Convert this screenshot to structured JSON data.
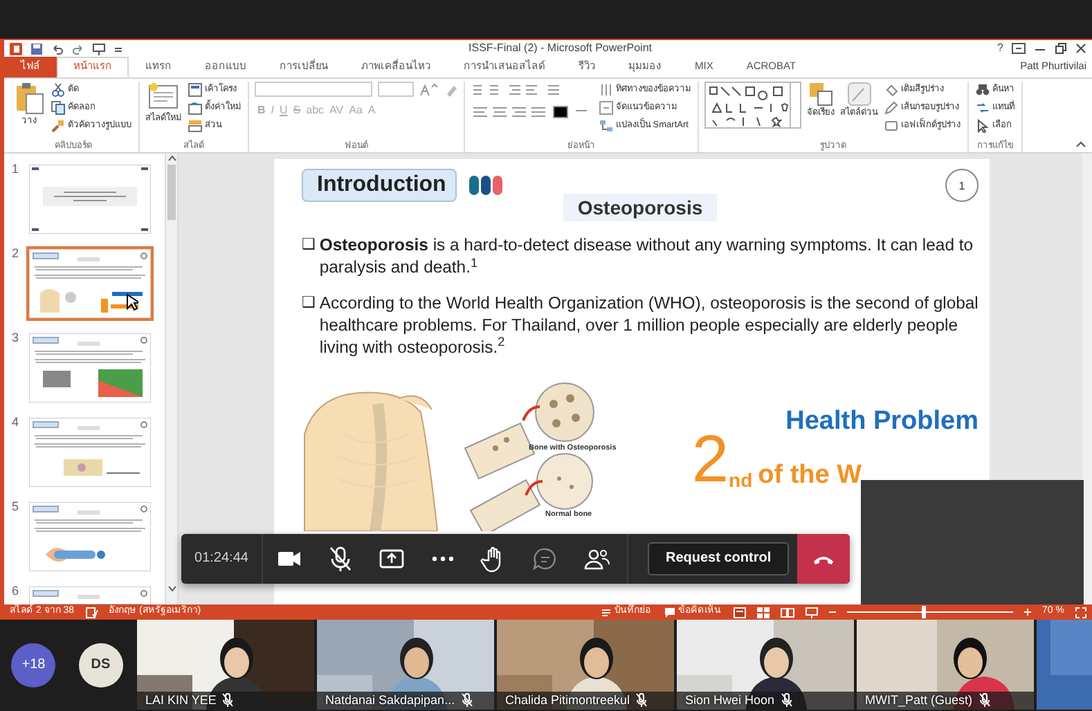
{
  "window": {
    "title": "ISSF-Final (2) - Microsoft PowerPoint",
    "help": "?",
    "user": "Patt Phurtivilai"
  },
  "tabs": [
    {
      "label": "ไฟล์",
      "kind": "file",
      "selected": false
    },
    {
      "label": "หน้าแรก",
      "kind": "tab",
      "selected": true
    },
    {
      "label": "แทรก",
      "kind": "tab",
      "selected": false
    },
    {
      "label": "ออกแบบ",
      "kind": "tab",
      "selected": false
    },
    {
      "label": "การเปลี่ยน",
      "kind": "tab",
      "selected": false
    },
    {
      "label": "ภาพเคลื่อนไหว",
      "kind": "tab",
      "selected": false
    },
    {
      "label": "การนำเสนอสไลด์",
      "kind": "tab",
      "selected": false
    },
    {
      "label": "รีวิว",
      "kind": "tab",
      "selected": false
    },
    {
      "label": "มุมมอง",
      "kind": "tab",
      "selected": false
    },
    {
      "label": "MIX",
      "kind": "tab",
      "selected": false
    },
    {
      "label": "ACROBAT",
      "kind": "tab",
      "selected": false
    }
  ],
  "ribbon": {
    "groups": [
      {
        "kind": "clipboard",
        "label": "คลิปบอร์ด",
        "items": [
          "วาง",
          "ตัด",
          "คัดลอก",
          "ตัวคัดวางรูปแบบ"
        ]
      },
      {
        "kind": "slides",
        "label": "สไลด์",
        "items": [
          "สไลด์ใหม่",
          "เค้าโครง",
          "ตั้งค่าใหม่",
          "ส่วน"
        ]
      },
      {
        "kind": "font",
        "label": "ฟอนต์",
        "disabled": true,
        "items": [
          "B",
          "I",
          "U",
          "S",
          "abc",
          "AV",
          "Aa",
          "A"
        ]
      },
      {
        "kind": "paragraph",
        "label": "ย่อหน้า",
        "items": [
          "ทิศทางของข้อความ",
          "จัดแนวข้อความ",
          "แปลงเป็น SmartArt"
        ]
      },
      {
        "kind": "drawing",
        "label": "รูปวาด",
        "items": [
          "จัดเรียง",
          "สไตล์ด่วน",
          "เติมสีรูปร่าง",
          "เส้นกรอบรูปร่าง",
          "เอฟเฟ็กต์รูปร่าง"
        ]
      },
      {
        "kind": "editing",
        "label": "การแก้ไข",
        "items": [
          "ค้นหา",
          "แทนที่",
          "เลือก"
        ]
      }
    ]
  },
  "slides": [
    {
      "number": "1",
      "selected": false
    },
    {
      "number": "2",
      "selected": true
    },
    {
      "number": "3",
      "selected": false
    },
    {
      "number": "4",
      "selected": false
    },
    {
      "number": "5",
      "selected": false
    },
    {
      "number": "6",
      "selected": false
    }
  ],
  "slide": {
    "title": "Introduction",
    "page": "1",
    "heading": "Osteoporosis",
    "bullets": [
      {
        "marker": "❑",
        "text": "**Osteoporosis** is a hard-to-detect disease without any warning symptoms. It can lead to paralysis and death.$^{1}$"
      },
      {
        "marker": "❑",
        "text": "According to the World Health Organization (WHO), osteoporosis is the second of global healthcare problems. For Thailand, over 1 million people especially are elderly people living with osteoporosis.$^{2}$"
      }
    ],
    "figure_labels": [
      "Bone with Osteoporosis",
      "Normal bone"
    ],
    "rank": "2",
    "rank_suffix": "nd",
    "rank_text": "of the W",
    "banner": "Health Problem"
  },
  "call_controls": {
    "time": "01:24:44",
    "mic_muted": true,
    "request_control": "Request control"
  },
  "status_bar": {
    "slide": "สไลด์ 2 จาก 38",
    "language": "อังกฤษ (สหรัฐอเมริกา)",
    "notes": "บันทึกย่อ",
    "comments": "ข้อคิดเห็น",
    "zoom": {
      "level": 0.45,
      "label": "70 %"
    }
  },
  "overflow_count": "+18",
  "avatar_initials": "DS",
  "participants": [
    {
      "name": "LAI KIN YEE",
      "muted": true
    },
    {
      "name": "Natdanai Sakdapipan...",
      "muted": true
    },
    {
      "name": "Chalida Pitimontreekul",
      "muted": true
    },
    {
      "name": "Sion Hwei Hoon",
      "muted": true
    },
    {
      "name": "MWIT_Patt (Guest)",
      "muted": true
    }
  ]
}
